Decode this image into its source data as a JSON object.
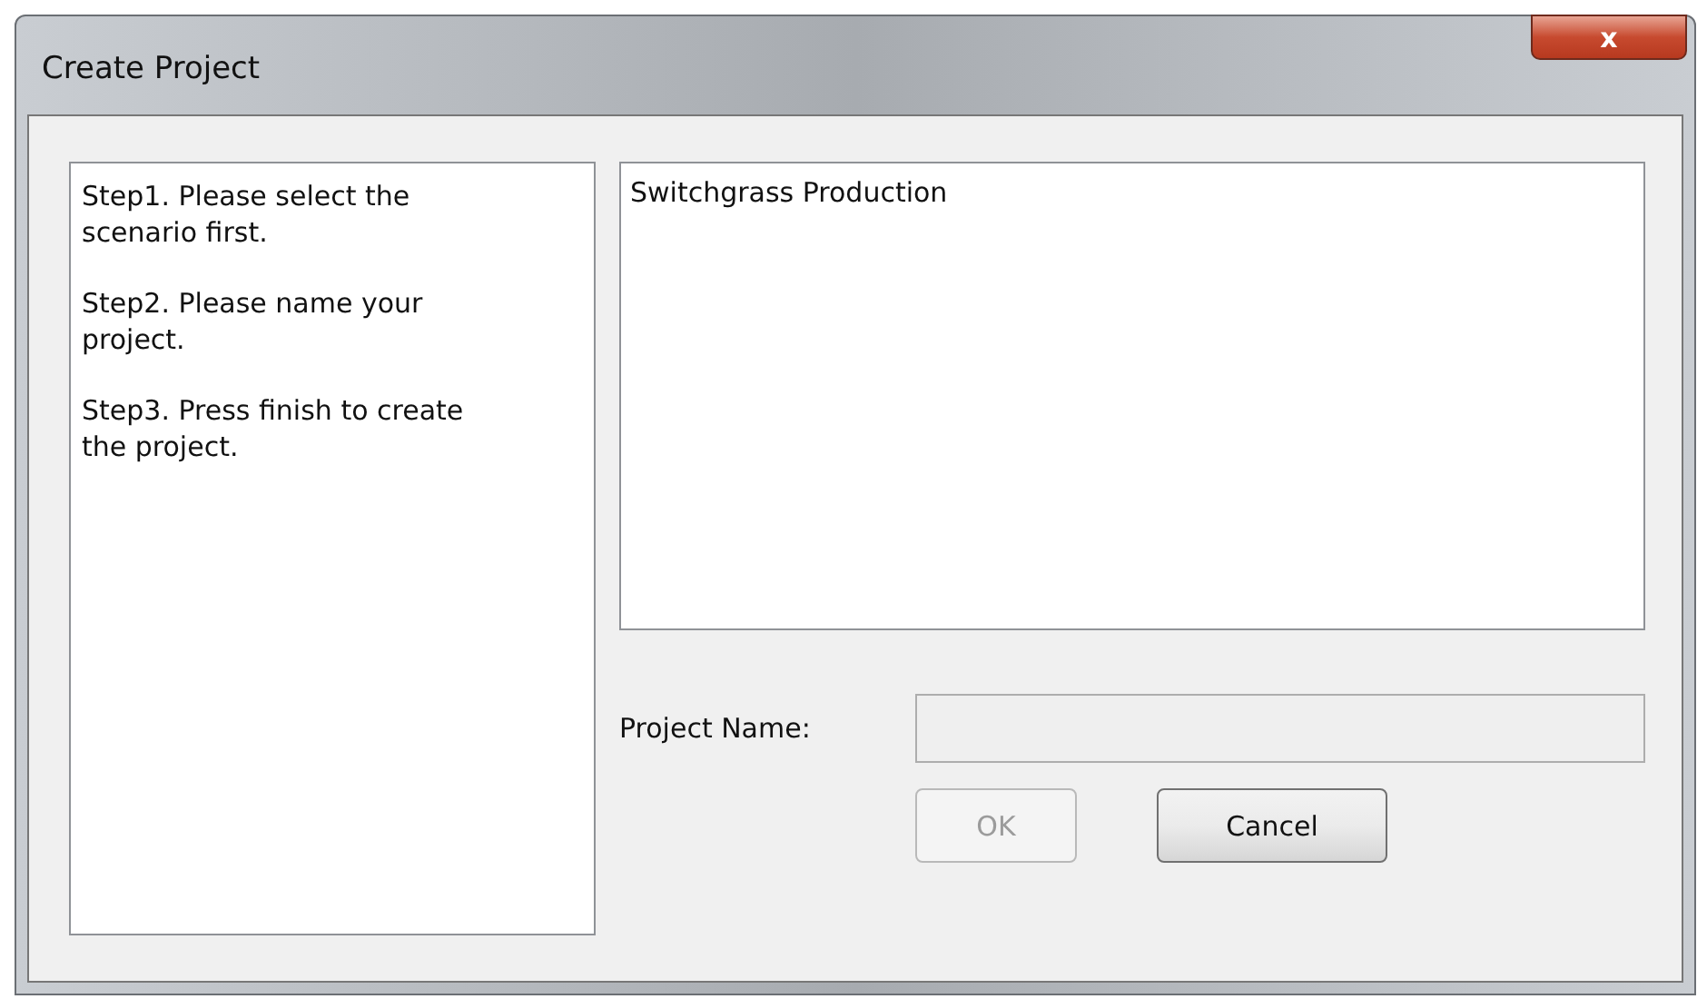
{
  "window": {
    "title": "Create Project",
    "close": "x"
  },
  "instructions": [
    "Step1. Please select the scenario first.",
    "Step2. Please name your project.",
    "Step3. Press finish to create the project."
  ],
  "scenarios": [
    {
      "label": "Switchgrass Production",
      "selected": false
    }
  ],
  "project_name": {
    "label": "Project Name:",
    "disabled": true
  },
  "buttons": [
    {
      "label": "OK",
      "disabled": true
    },
    {
      "label": "Cancel",
      "disabled": false
    }
  ]
}
